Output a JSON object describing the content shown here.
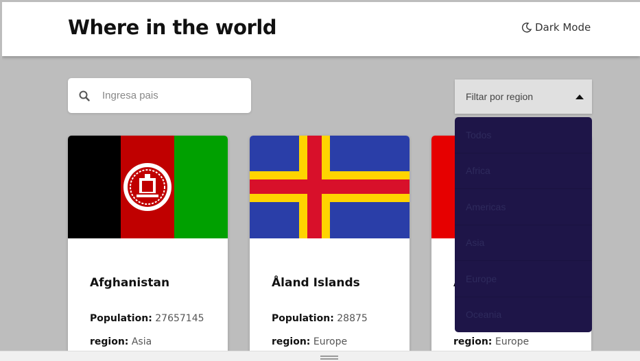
{
  "header": {
    "title": "Where in the world",
    "dark_mode_label": "Dark Mode"
  },
  "search": {
    "placeholder": "Ingresa pais"
  },
  "filter": {
    "label": "Filtar por region",
    "options": [
      "Todos",
      "Africa",
      "Americas",
      "Asia",
      "Europe",
      "Oceania"
    ]
  },
  "cards": [
    {
      "name": "Afghanistan",
      "population_label": "Population:",
      "population": "27657145",
      "region_label": "region:",
      "region": "Asia"
    },
    {
      "name": "Åland Islands",
      "population_label": "Population:",
      "population": "28875",
      "region_label": "region:",
      "region": "Europe"
    },
    {
      "name": "A",
      "population_label": "",
      "population": "",
      "region_label": "region:",
      "region": "Europe"
    }
  ],
  "colors": {
    "dropdown_bg": "#1e1548",
    "afghan_black": "#000000",
    "afghan_red": "#c00000",
    "afghan_green": "#00a000",
    "aland_blue": "#2a3ea8",
    "aland_yellow": "#ffd400",
    "aland_red": "#d8102a"
  }
}
